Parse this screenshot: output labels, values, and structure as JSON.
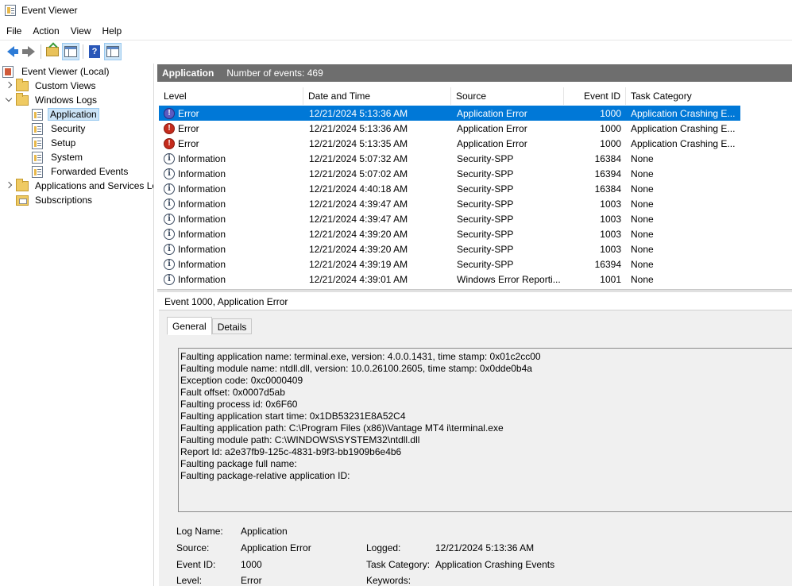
{
  "window": {
    "title": "Event Viewer"
  },
  "menu": [
    "File",
    "Action",
    "View",
    "Help"
  ],
  "toolbar": {
    "icons": [
      "back-arrow-icon",
      "forward-arrow-icon",
      "folder-up-icon",
      "show-hide-console-tree-icon",
      "help-icon",
      "show-hide-action-pane-icon"
    ]
  },
  "tree": {
    "root": "Event Viewer (Local)",
    "custom_views": "Custom Views",
    "windows_logs": "Windows Logs",
    "logs": [
      "Application",
      "Security",
      "Setup",
      "System",
      "Forwarded Events"
    ],
    "apps_services": "Applications and Services Lo",
    "subscriptions": "Subscriptions"
  },
  "header": {
    "title": "Application",
    "count": "Number of events: 469"
  },
  "columns": {
    "level": "Level",
    "datetime": "Date and Time",
    "source": "Source",
    "event_id": "Event ID",
    "task": "Task Category"
  },
  "events": [
    {
      "level": "Error",
      "datetime": "12/21/2024 5:13:36 AM",
      "source": "Application Error",
      "event_id": "1000",
      "task": "Application Crashing E..."
    },
    {
      "level": "Error",
      "datetime": "12/21/2024 5:13:36 AM",
      "source": "Application Error",
      "event_id": "1000",
      "task": "Application Crashing E..."
    },
    {
      "level": "Error",
      "datetime": "12/21/2024 5:13:35 AM",
      "source": "Application Error",
      "event_id": "1000",
      "task": "Application Crashing E..."
    },
    {
      "level": "Information",
      "datetime": "12/21/2024 5:07:32 AM",
      "source": "Security-SPP",
      "event_id": "16384",
      "task": "None"
    },
    {
      "level": "Information",
      "datetime": "12/21/2024 5:07:02 AM",
      "source": "Security-SPP",
      "event_id": "16394",
      "task": "None"
    },
    {
      "level": "Information",
      "datetime": "12/21/2024 4:40:18 AM",
      "source": "Security-SPP",
      "event_id": "16384",
      "task": "None"
    },
    {
      "level": "Information",
      "datetime": "12/21/2024 4:39:47 AM",
      "source": "Security-SPP",
      "event_id": "1003",
      "task": "None"
    },
    {
      "level": "Information",
      "datetime": "12/21/2024 4:39:47 AM",
      "source": "Security-SPP",
      "event_id": "1003",
      "task": "None"
    },
    {
      "level": "Information",
      "datetime": "12/21/2024 4:39:20 AM",
      "source": "Security-SPP",
      "event_id": "1003",
      "task": "None"
    },
    {
      "level": "Information",
      "datetime": "12/21/2024 4:39:20 AM",
      "source": "Security-SPP",
      "event_id": "1003",
      "task": "None"
    },
    {
      "level": "Information",
      "datetime": "12/21/2024 4:39:19 AM",
      "source": "Security-SPP",
      "event_id": "16394",
      "task": "None"
    },
    {
      "level": "Information",
      "datetime": "12/21/2024 4:39:01 AM",
      "source": "Windows Error Reporti...",
      "event_id": "1001",
      "task": "None"
    }
  ],
  "selected_event": 0,
  "detail": {
    "title": "Event 1000, Application Error",
    "tabs": [
      "General",
      "Details"
    ],
    "description": [
      "Faulting application name: terminal.exe, version: 4.0.0.1431, time stamp: 0x01c2cc00",
      "Faulting module name: ntdll.dll, version: 10.0.26100.2605, time stamp: 0x0dde0b4a",
      "Exception code: 0xc0000409",
      "Fault offset: 0x0007d5ab",
      "Faulting process id: 0x6F60",
      "Faulting application start time: 0x1DB53231E8A52C4",
      "Faulting application path: C:\\Program Files (x86)\\Vantage MT4 i\\terminal.exe",
      "Faulting module path: C:\\WINDOWS\\SYSTEM32\\ntdll.dll",
      "Report Id: a2e37fb9-125c-4831-b9f3-bb1909b6e4b6",
      "Faulting package full name: ",
      "Faulting package-relative application ID: "
    ],
    "fields": {
      "log_name_label": "Log Name:",
      "log_name": "Application",
      "source_label": "Source:",
      "source": "Application Error",
      "logged_label": "Logged:",
      "logged": "12/21/2024 5:13:36 AM",
      "event_id_label": "Event ID:",
      "event_id": "1000",
      "task_label": "Task Category:",
      "task": "Application Crashing Events",
      "level_label": "Level:",
      "level": "Error",
      "keywords_label": "Keywords:",
      "keywords": ""
    }
  },
  "colors": {
    "selection": "#0078d7",
    "header_bar": "#6e6e6e",
    "error": "#c42b1c"
  }
}
